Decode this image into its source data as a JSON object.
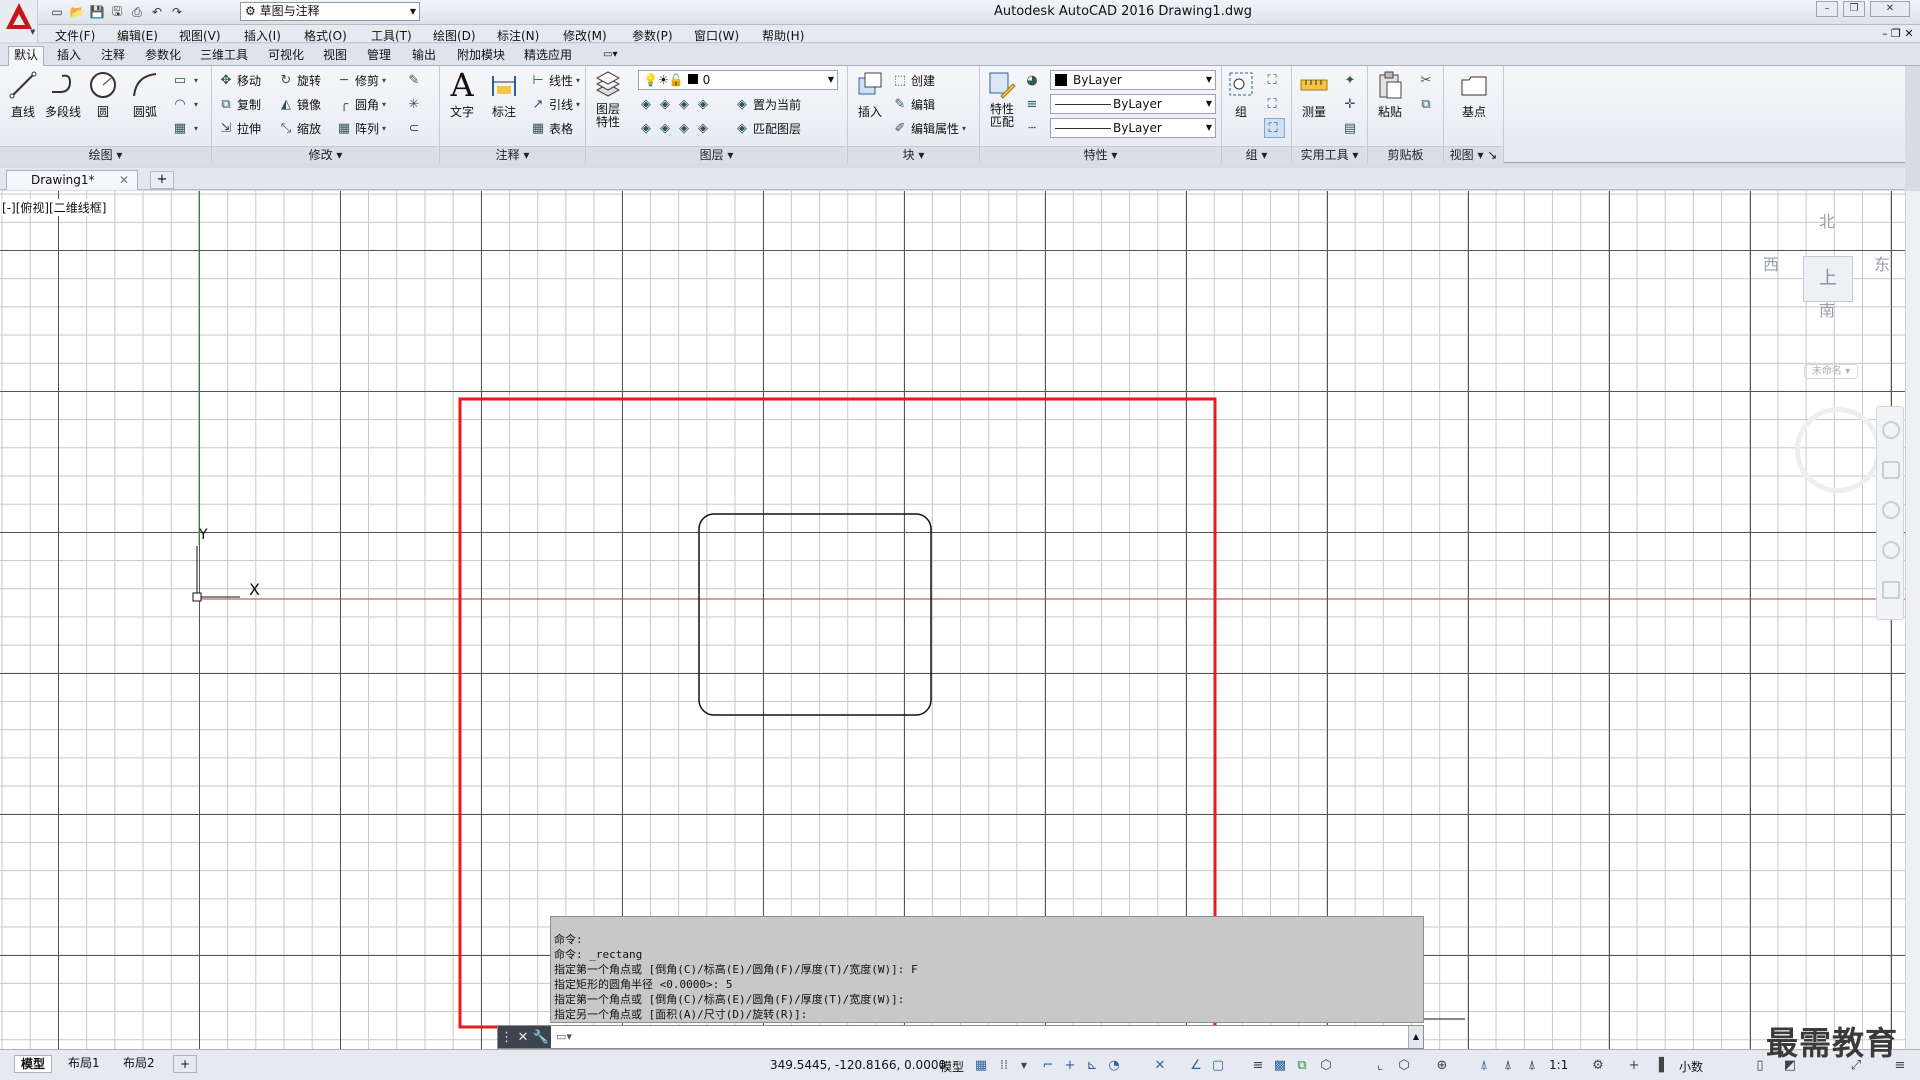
{
  "window": {
    "title": "Autodesk AutoCAD 2016    Drawing1.dwg",
    "workspace": "草图与注释",
    "controls": [
      "–",
      "❐",
      "✕"
    ]
  },
  "menu": [
    "文件(F)",
    "编辑(E)",
    "视图(V)",
    "插入(I)",
    "格式(O)",
    "工具(T)",
    "绘图(D)",
    "标注(N)",
    "修改(M)",
    "参数(P)",
    "窗口(W)",
    "帮助(H)"
  ],
  "ribbon_tabs": [
    "默认",
    "插入",
    "注释",
    "参数化",
    "三维工具",
    "可视化",
    "视图",
    "管理",
    "输出",
    "附加模块",
    "精选应用"
  ],
  "ribbon": {
    "draw": {
      "label": "绘图",
      "line": "直线",
      "polyline": "多段线",
      "circle": "圆",
      "arc": "圆弧"
    },
    "modify": {
      "label": "修改",
      "move": "移动",
      "rotate": "旋转",
      "trim": "修剪",
      "copy": "复制",
      "mirror": "镜像",
      "fillet": "圆角",
      "stretch": "拉伸",
      "scale": "缩放",
      "array": "阵列"
    },
    "annotation": {
      "label": "注释",
      "text": "文字",
      "dimension": "标注",
      "linear": "线性",
      "leader": "引线",
      "table": "表格"
    },
    "layers": {
      "label": "图层",
      "properties": "图层\n特性",
      "layer_value": "0",
      "set_current": "置为当前",
      "match_layer": "匹配图层"
    },
    "block": {
      "label": "块",
      "insert": "插入",
      "create": "创建",
      "edit": "编辑",
      "edit_attributes": "编辑属性"
    },
    "properties": {
      "label": "特性",
      "match": "特性\n匹配",
      "color": "ByLayer",
      "lineweight": "ByLayer",
      "linetype": "ByLayer"
    },
    "groups": {
      "label": "组",
      "group": "组"
    },
    "utilities": {
      "label": "实用工具",
      "measure": "测量"
    },
    "clipboard": {
      "label": "剪贴板",
      "paste": "粘贴"
    },
    "view": {
      "label": "视图",
      "base": "基点"
    }
  },
  "file_tab": {
    "name": "Drawing1*"
  },
  "viewport_label": "[-][俯视][二维线框]",
  "viewcube": {
    "north": "北",
    "south": "南",
    "east": "东",
    "west": "西",
    "top": "上",
    "unnamed": "未命名"
  },
  "ucs": {
    "y": "Y",
    "x": "X"
  },
  "command_history": [
    "命令:",
    "命令: _rectang",
    "指定第一个角点或 [倒角(C)/标高(E)/圆角(F)/厚度(T)/宽度(W)]: F",
    "指定矩形的圆角半径 <0.0000>: 5",
    "指定第一个角点或 [倒角(C)/标高(E)/圆角(F)/厚度(T)/宽度(W)]:",
    "指定另一个角点或 [面积(A)/尺寸(D)/旋转(R)]:"
  ],
  "statusbar": {
    "layout_tabs": [
      "模型",
      "布局1",
      "布局2"
    ],
    "coords": "349.5445, -120.8166, 0.0000",
    "model": "模型",
    "scale": "1:1",
    "units": "小数"
  },
  "watermark": "最需教育",
  "colors": {
    "highlight": "#e8191f",
    "x_axis": "#c83232",
    "y_axis": "#3ca03c",
    "brand": "#c4161c"
  }
}
